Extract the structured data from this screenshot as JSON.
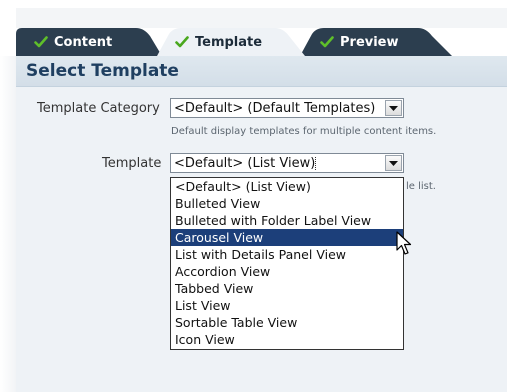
{
  "tabs": [
    {
      "label": "Content",
      "state": "completed"
    },
    {
      "label": "Template",
      "state": "active"
    },
    {
      "label": "Preview",
      "state": "completed"
    }
  ],
  "panel": {
    "title": "Select Template"
  },
  "template_category": {
    "label": "Template Category",
    "value": "<Default> (Default Templates)",
    "hint": "Default display templates for multiple content items."
  },
  "template": {
    "label": "Template",
    "value": "<Default> (List View)",
    "hint_partial": "le list.",
    "options": [
      "<Default> (List View)",
      "Bulleted View",
      "Bulleted with Folder Label View",
      "Carousel View",
      "List with Details Panel View",
      "Accordion View",
      "Tabbed View",
      "List View",
      "Sortable Table View",
      "Icon View"
    ],
    "highlighted_option": "Carousel View"
  },
  "colors": {
    "tab_active_bg": "#eef2f6",
    "tab_inactive_bg": "#2c3e4f",
    "check_green": "#5fbf2a",
    "panel_bg": "#eef2f6",
    "title_color": "#1f3f61",
    "selection_bg": "#1c3f7a"
  },
  "icons": {
    "tab_check": "checkmark-icon",
    "select_arrow": "triangle-down-icon",
    "cursor": "arrow-pointer-icon"
  }
}
